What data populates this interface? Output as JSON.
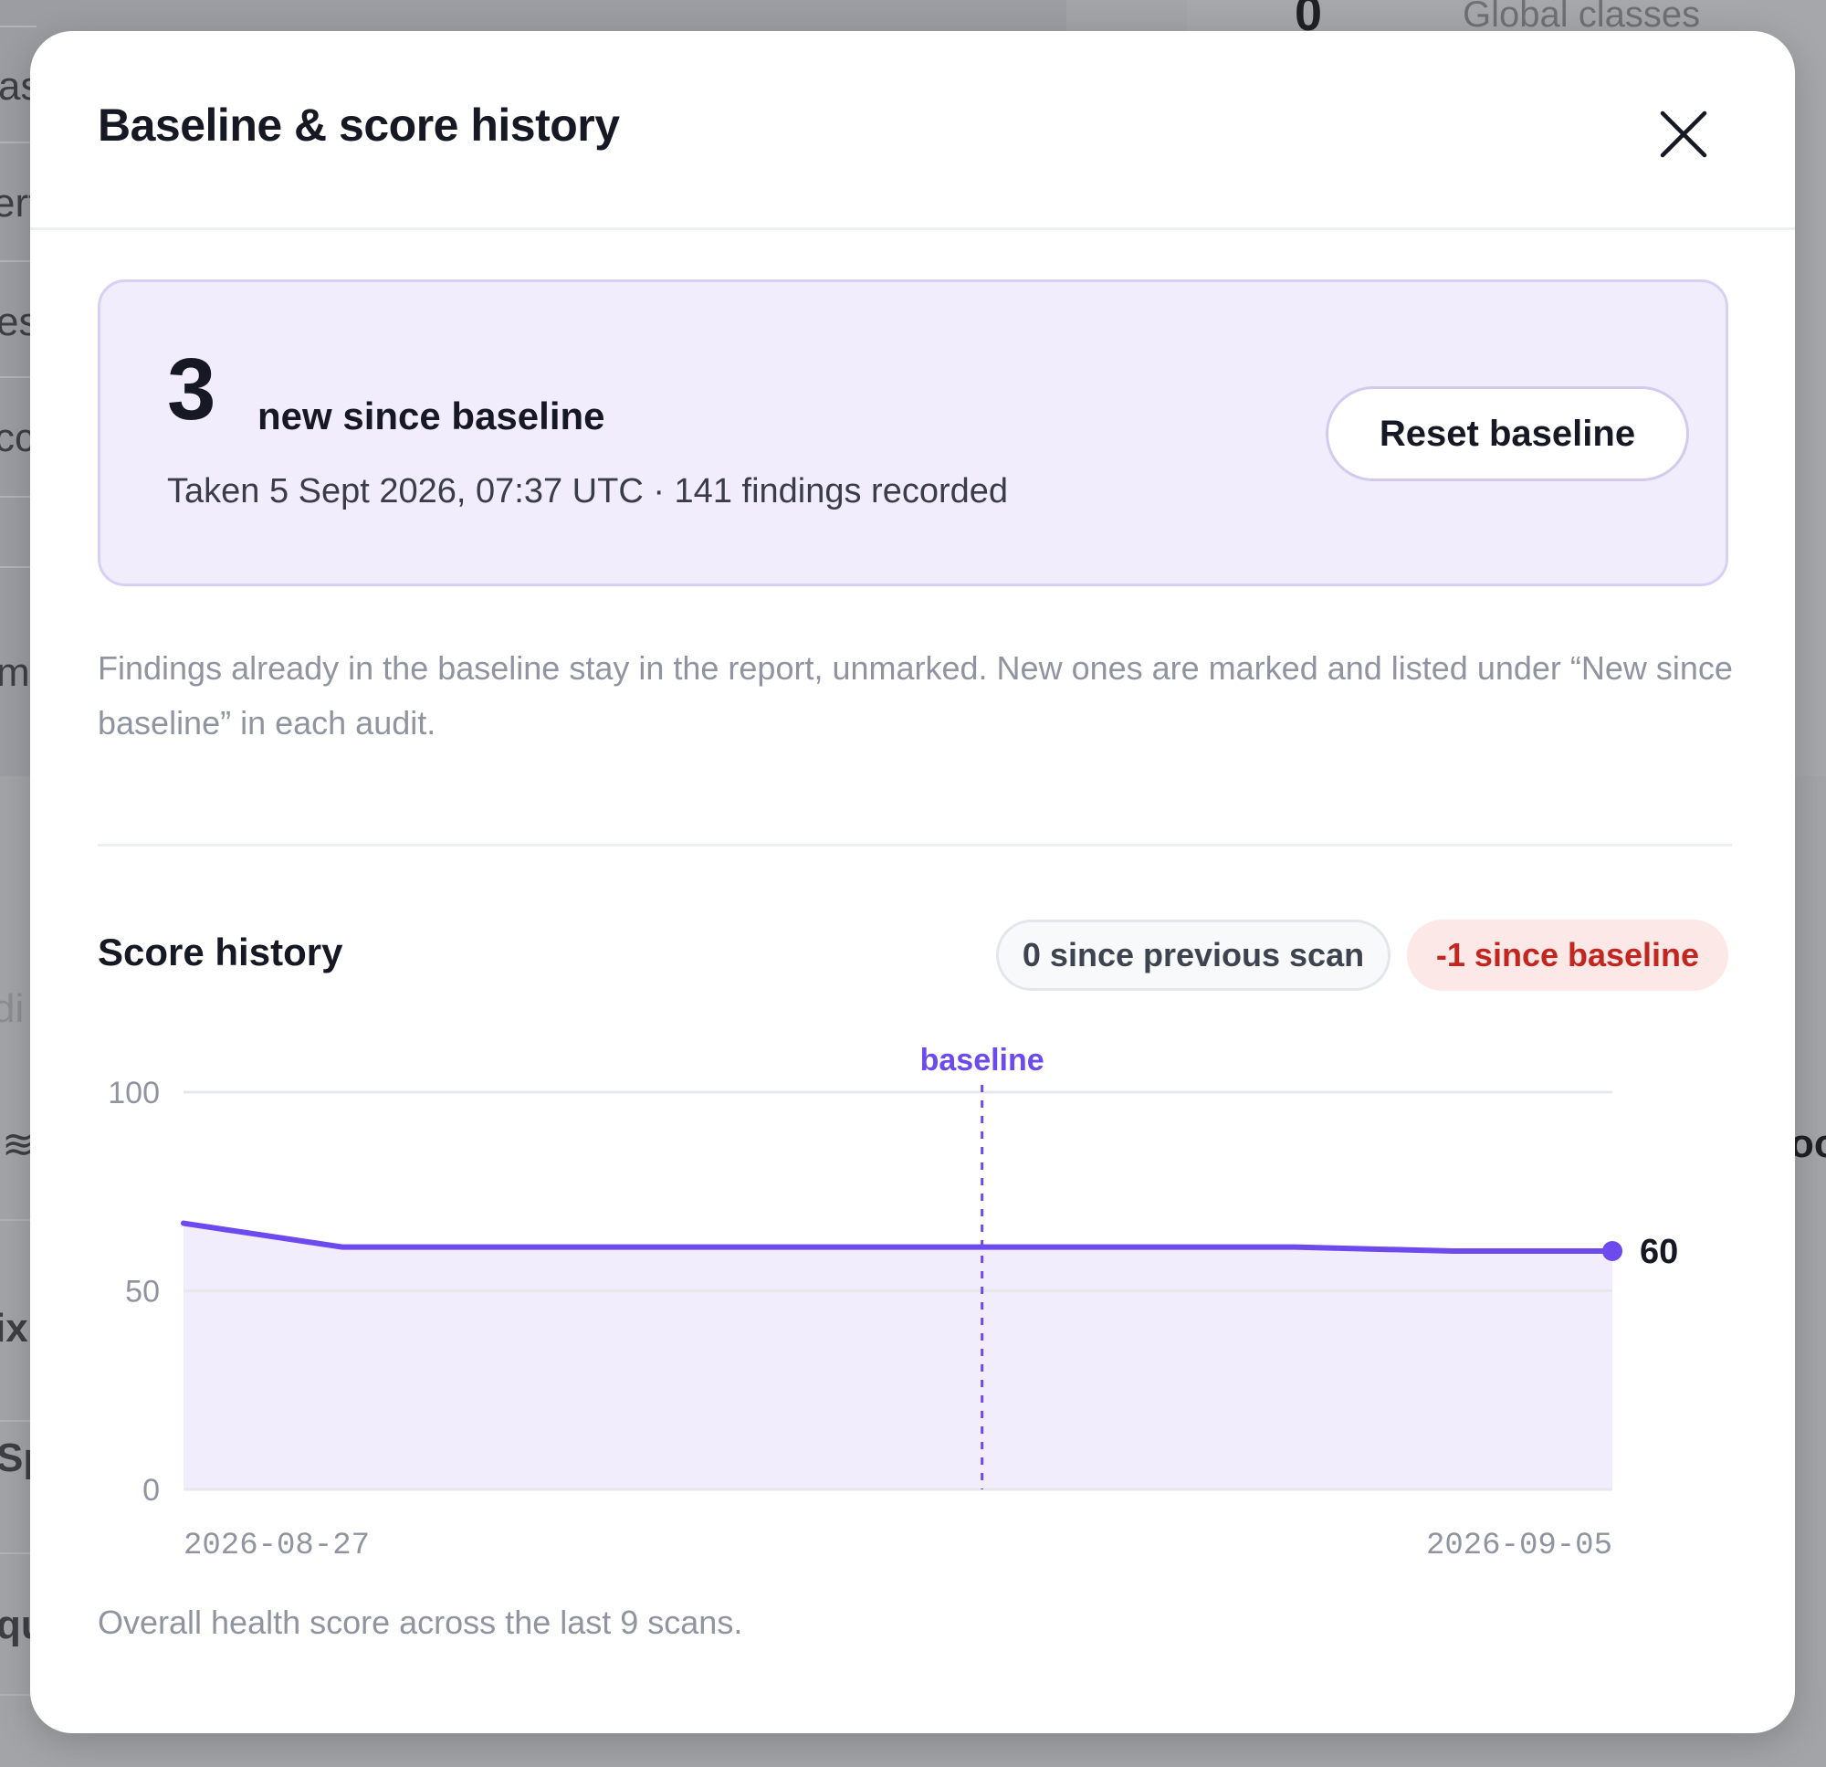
{
  "background": {
    "top_number": "0",
    "top_label": "Global classes",
    "left_fragments": [
      "as",
      "erf",
      "es",
      "cc",
      "ma",
      "di",
      "ix",
      "Sp",
      "qu"
    ],
    "right_fragment": "oo"
  },
  "modal": {
    "title": "Baseline & score history",
    "close_icon": "close-icon"
  },
  "baseline": {
    "new_count": "3",
    "new_label": "new since baseline",
    "meta": "Taken 5 Sept 2026, 07:37 UTC · 141 findings recorded",
    "reset_label": "Reset baseline",
    "explanation": "Findings already in the baseline stay in the report, unmarked. New ones are marked and listed under “New since baseline” in each audit."
  },
  "score_history": {
    "title": "Score history",
    "since_previous": "0 since previous scan",
    "since_baseline": "-1 since baseline",
    "caption": "Overall health score across the last 9 scans."
  },
  "colors": {
    "accent": "#6d4aed",
    "accent_fill": "#f1edfd",
    "negative": "#c2261f"
  },
  "chart_data": {
    "type": "area",
    "x": [
      "2026-08-27",
      "2026-08-28",
      "2026-08-29",
      "2026-08-30",
      "2026-08-31",
      "2026-09-01",
      "2026-09-02",
      "2026-09-03",
      "2026-09-04",
      "2026-09-05"
    ],
    "values": [
      67,
      61,
      61,
      61,
      61,
      61,
      61,
      61,
      60,
      60
    ],
    "yticks": [
      "0",
      "50",
      "100"
    ],
    "ylim": [
      0,
      100
    ],
    "xtick_labels": [
      "2026-08-27",
      "2026-09-05"
    ],
    "baseline_index": 5,
    "baseline_label": "baseline",
    "last_value_label": "60",
    "grid": true
  }
}
